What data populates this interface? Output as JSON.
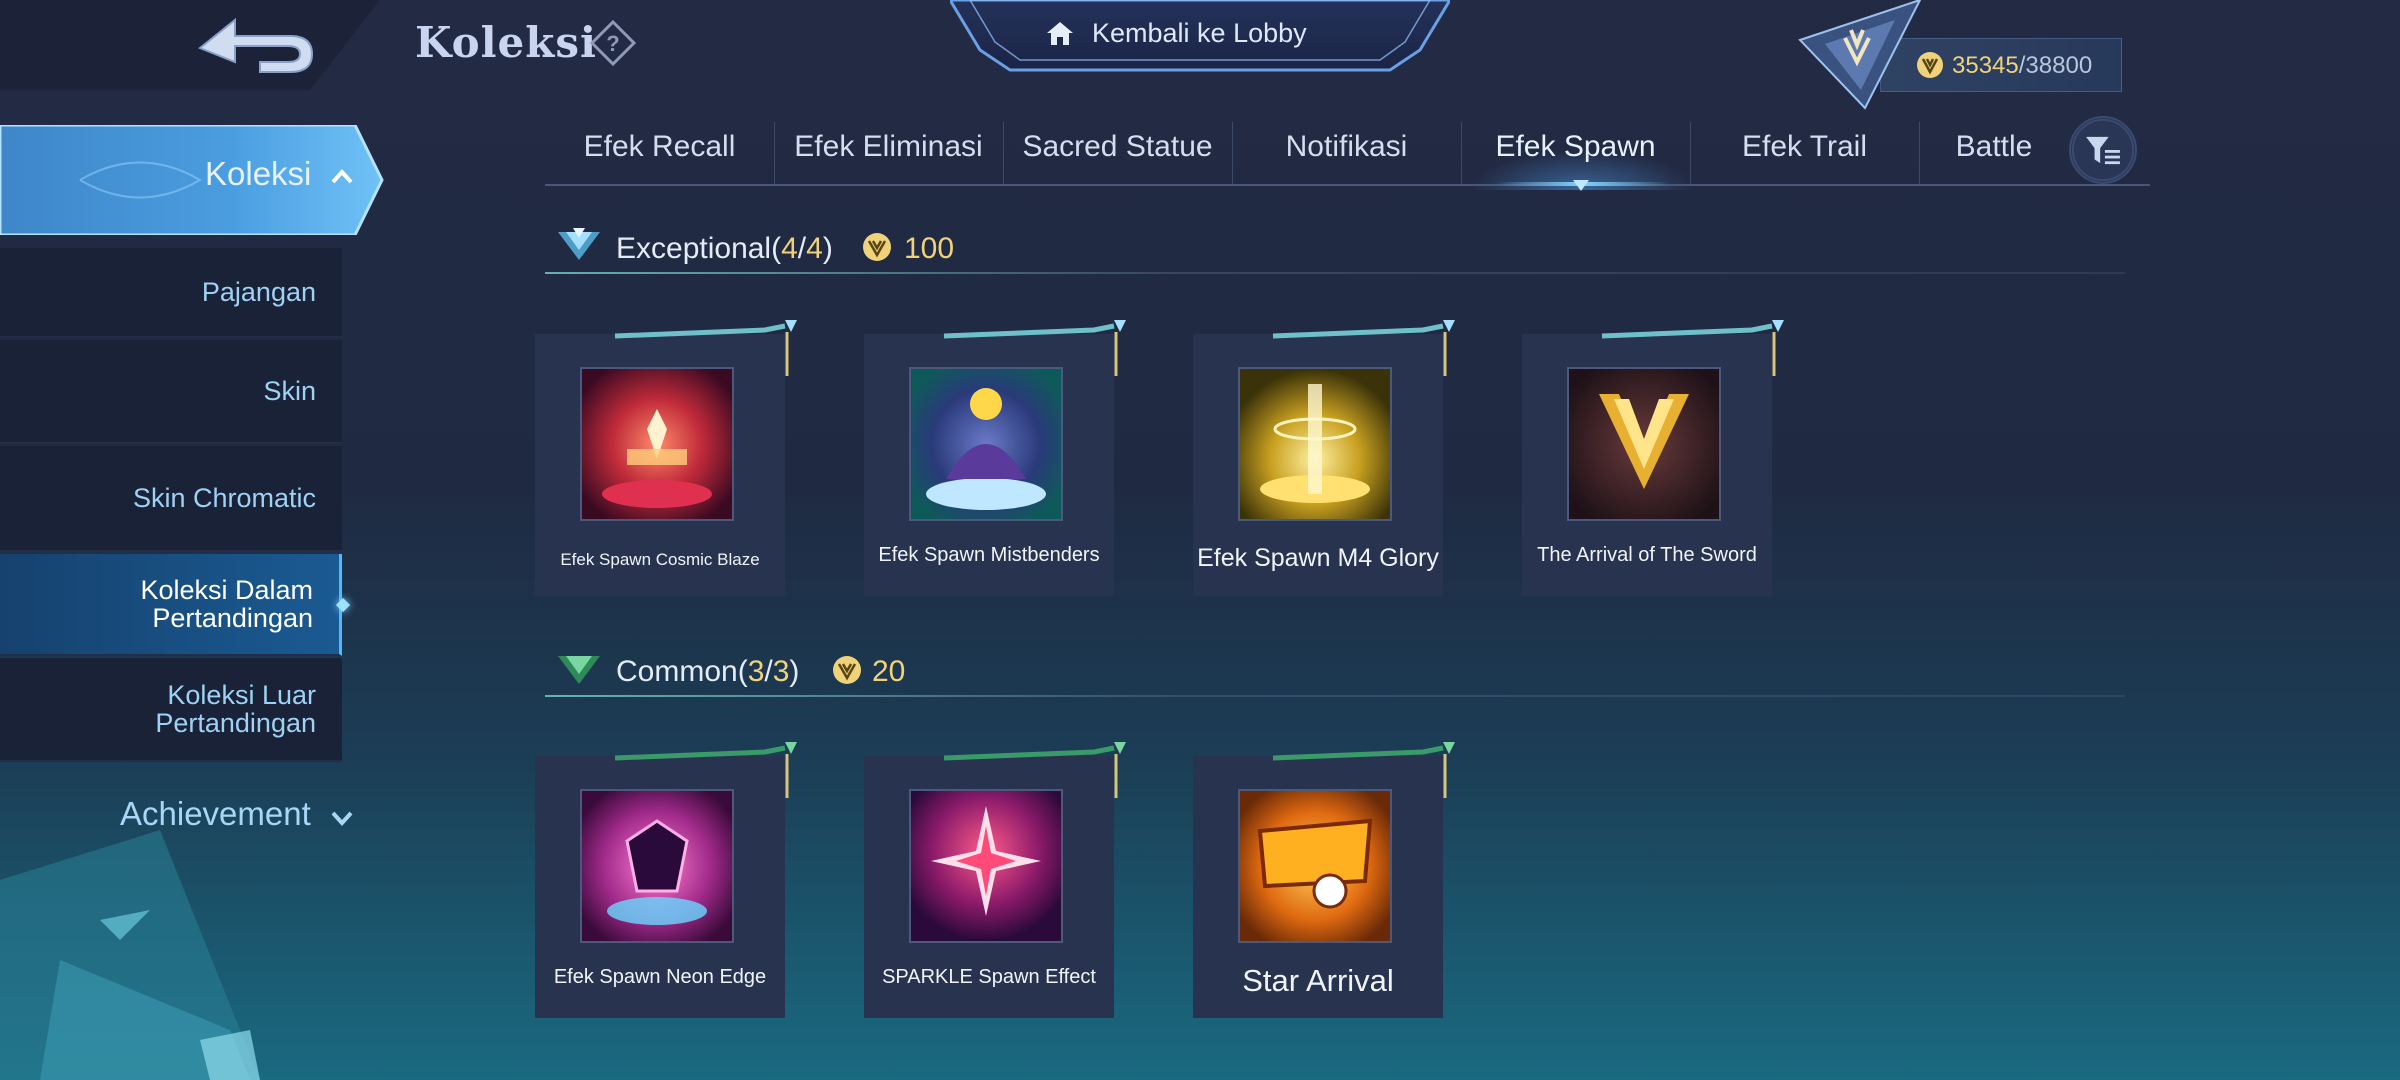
{
  "header": {
    "title": "Koleksi",
    "lobby_label": "Kembali ke Lobby",
    "points_current": "35345",
    "points_separator": "/",
    "points_max": "38800"
  },
  "sidebar": {
    "main": "Koleksi",
    "items": [
      {
        "label": "Pajangan",
        "active": false
      },
      {
        "label": "Skin",
        "active": false
      },
      {
        "label": "Skin Chromatic",
        "active": false
      },
      {
        "label": "Koleksi Dalam\nPertandingan",
        "line1": "Koleksi Dalam",
        "line2": "Pertandingan",
        "active": true
      },
      {
        "label": "Koleksi Luar\nPertandingan",
        "line1": "Koleksi Luar",
        "line2": "Pertandingan",
        "active": false
      }
    ],
    "achievement": "Achievement"
  },
  "tabs": [
    {
      "label": "Efek Recall",
      "active": false
    },
    {
      "label": "Efek Eliminasi",
      "active": false
    },
    {
      "label": "Sacred Statue",
      "active": false
    },
    {
      "label": "Notifikasi",
      "active": false
    },
    {
      "label": "Efek Spawn",
      "active": true
    },
    {
      "label": "Efek Trail",
      "active": false
    },
    {
      "label": "Battle",
      "active": false
    }
  ],
  "sections": [
    {
      "title": "Exceptional",
      "count_open": "(",
      "count": "4",
      "count_sep": "/",
      "count_total": "4",
      "count_close": ")",
      "points": "100",
      "items": [
        {
          "name": "Efek Spawn Cosmic Blaze",
          "icon": "cosmic-blaze-icon"
        },
        {
          "name": "Efek Spawn Mistbenders",
          "icon": "mistbenders-icon"
        },
        {
          "name": "Efek Spawn M4 Glory",
          "icon": "m4-glory-icon"
        },
        {
          "name": "The Arrival of The Sword",
          "icon": "sword-icon"
        }
      ]
    },
    {
      "title": "Common",
      "count_open": "(",
      "count": "3",
      "count_sep": "/",
      "count_total": "3",
      "count_close": ")",
      "points": "20",
      "items": [
        {
          "name": "Efek Spawn Neon Edge",
          "icon": "neon-edge-icon"
        },
        {
          "name": "SPARKLE Spawn Effect",
          "icon": "sparkle-icon"
        },
        {
          "name": "Star Arrival",
          "icon": "goal-icon"
        }
      ]
    }
  ],
  "colors": {
    "accent_gold": "#f0d27a",
    "accent_blue": "#7fd4ff",
    "card_bg": "#283350",
    "sidebar_active": "#1a5a92"
  }
}
